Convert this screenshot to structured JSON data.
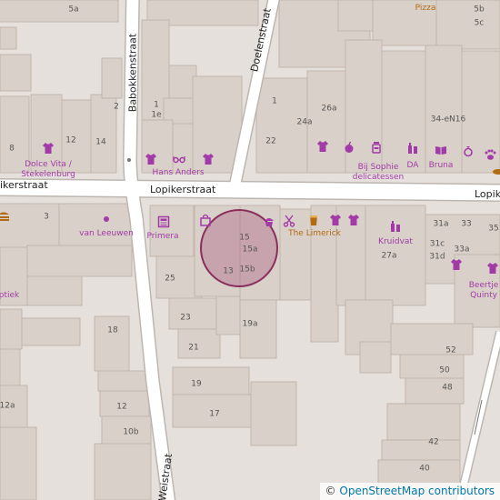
{
  "map": {
    "colors": {
      "background": "#e5e0dc",
      "building": "#d9d0c9",
      "building_stroke": "#c4b6ab",
      "road": "#ffffff",
      "road_casing": "#bdb6b0",
      "poi": "#a23ba7",
      "poi_alt": "#b36b12",
      "marker_fill": "#a03a6e",
      "marker_stroke": "#8a2f5c"
    },
    "streets": {
      "lopikerstraat_west": "ikerstraat",
      "lopikerstraat_mid": "Lopikerstraat",
      "lopikerstraat_east": "Lopik",
      "babokkenstraat": "Babokkenstraat",
      "doelenstraat": "Doelenstraat",
      "weistraat": "Weistraat"
    },
    "pois": {
      "pizza": "Pizza",
      "dolce_vita_1": "Dolce Vita /",
      "dolce_vita_2": "Stekelenburg",
      "hans_anders": "Hans Anders",
      "bij_sophie_1": "Bij Sophie",
      "bij_sophie_2": "delicatessen",
      "da": "DA",
      "bruna": "Bruna",
      "van_leeuwen": "van Leeuwen",
      "primera": "Primera",
      "the_limerick": "The Limerick",
      "kruidvat": "Kruidvat",
      "optiek": "ptiek",
      "beertje_1": "Beertje",
      "beertje_2": "Quinty"
    },
    "house_numbers": {
      "n5a": "5a",
      "n5b": "5b",
      "n5c": "5c",
      "n1": "1",
      "n1e": "1e",
      "n2": "2",
      "n8": "8",
      "n12a": "12",
      "n14": "14",
      "n1b": "1",
      "n26a": "26a",
      "n24a": "24a",
      "n22": "22",
      "n34eN16": "34-eN16",
      "n3": "3",
      "n15": "15",
      "n15a": "15a",
      "n13": "13",
      "n15b": "15b",
      "n25": "25",
      "n23": "23",
      "n19a": "19a",
      "n21": "21",
      "n18": "18",
      "n19": "19",
      "n17": "17",
      "n12b": "12",
      "n12a2": "12a",
      "n10b": "10b",
      "n31a": "31a",
      "n33": "33",
      "n35": "35",
      "n31c": "31c",
      "n33a": "33a",
      "n31d": "31d",
      "n27a": "27a",
      "n52": "52",
      "n50": "50",
      "n48": "48",
      "n42": "42",
      "n40": "40"
    },
    "icons": [
      "clothes-icon",
      "glasses-icon",
      "apple-icon",
      "jar-icon",
      "bottles-icon",
      "book-icon",
      "ring-icon",
      "paw-icon",
      "newspaper-icon",
      "shopping-bag-icon",
      "cupcake-icon",
      "scissors-icon",
      "beer-icon",
      "dot-icon"
    ],
    "marker": {
      "shape": "circle",
      "color": "#a03a6e"
    }
  },
  "attribution": {
    "copyright": "©",
    "link_text": "OpenStreetMap contributors"
  }
}
